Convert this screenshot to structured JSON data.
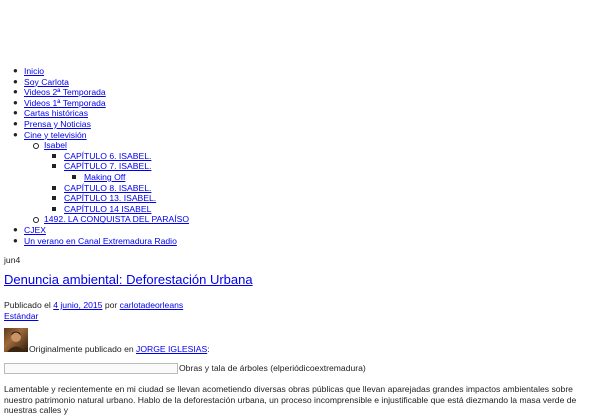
{
  "nav": {
    "items": [
      {
        "label": "Inicio"
      },
      {
        "label": "Soy Carlota"
      },
      {
        "label": "Videos 2ª Temporada"
      },
      {
        "label": "Videos 1ª Temporada"
      },
      {
        "label": "Cartas históricas"
      },
      {
        "label": "Prensa y Noticias"
      },
      {
        "label": "Cine y televisión"
      },
      {
        "label": "CJEX"
      },
      {
        "label": "Un verano en Canal Extremadura Radio"
      }
    ],
    "sub": {
      "isabel": "Isabel",
      "cap6": "CAPÍTULO 6. ISABEL.",
      "cap7": "CAPÍTULO 7. ISABEL.",
      "making_off": "Making Off",
      "cap8": "CAPÍTULO 8. ISABEL.",
      "cap13": "CAPÍTULO 13. ISABEL.",
      "cap14": "CAPÍTULO 14 ISABEL",
      "conquista": "1492. LA CONQUISTA DEL PARAÍSO"
    }
  },
  "post": {
    "date": "jun4",
    "title": "Denuncia ambiental: Deforestación Urbana",
    "published_prefix": "Publicado el",
    "published_date": "4 junio, 2015",
    "by": "por",
    "author": "carlotadeorleans",
    "format": "Estándar",
    "orig_prefix": "Originalmente publicado en",
    "orig_source": "JORGE IGLESIAS",
    "orig_suffix": ":",
    "image_caption": "Obras y tala de árboles (elperiódicoextremadura)",
    "paragraph": "Lamentable y recientemente en mi ciudad se llevan acometiendo diversas obras públicas que llevan aparejadas grandes impactos ambientales sobre nuestro patrimonio natural urbano. Hablo de la deforestación urbana, un proceso incomprensible e injustificable que está diezmando la masa verde de nuestras calles y"
  }
}
